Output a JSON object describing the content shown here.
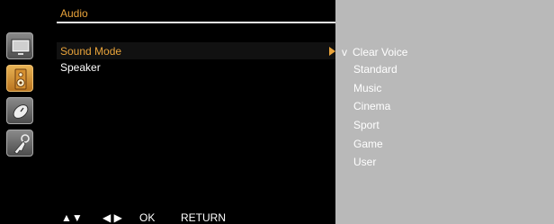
{
  "menu": {
    "title": "Audio",
    "items": [
      {
        "label": "Sound Mode",
        "selected": true
      },
      {
        "label": "Speaker",
        "selected": false
      }
    ]
  },
  "submenu": {
    "check_mark": "v",
    "options": [
      "Clear Voice",
      "Standard",
      "Music",
      "Cinema",
      "Sport",
      "Game",
      "User"
    ],
    "selected": "Clear Voice"
  },
  "footer": {
    "updown": "▲▼",
    "leftright": "◀ ▶",
    "ok": "OK",
    "return": "RETURN"
  },
  "icons": [
    "picture-icon",
    "audio-speaker-icon",
    "time-clock-icon",
    "option-key-icon"
  ],
  "colors": {
    "accent": "#e9a33a",
    "panel": "#b9b9b9",
    "background": "#000000"
  }
}
